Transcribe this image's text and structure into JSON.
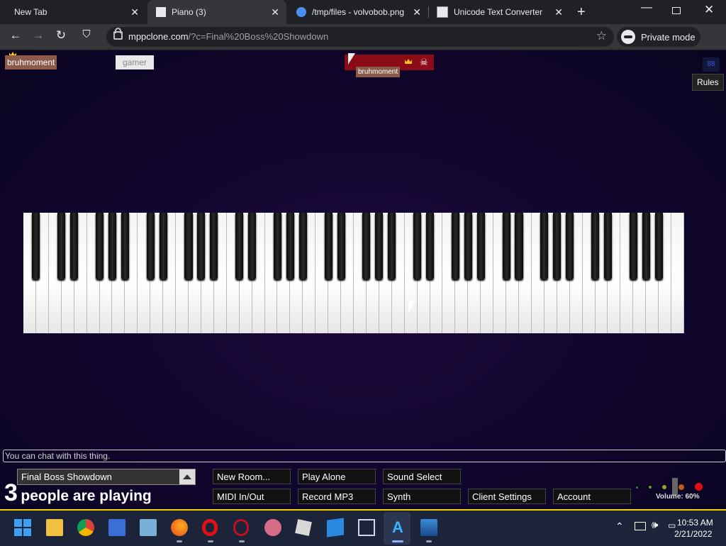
{
  "tabs": [
    {
      "title": "New Tab",
      "active": false
    },
    {
      "title": "Piano (3)",
      "active": true
    },
    {
      "title": "/tmp/files - volvobob.png",
      "active": false
    },
    {
      "title": "Unicode Text Converter",
      "active": false
    }
  ],
  "address": {
    "host": "mppclone.com",
    "path": "/?c=Final%20Boss%20Showdown",
    "private_label": "Private mode"
  },
  "players": {
    "tag1": "bruhmoment",
    "tag2": "gamer",
    "tag3": "bruhmoment"
  },
  "rules_label": "Rules",
  "chat_placeholder": "You can chat with this thing.",
  "room": {
    "name": "Final Boss Showdown"
  },
  "player_count": {
    "number": "3",
    "text": "people are playing"
  },
  "buttons": {
    "new_room": "New Room...",
    "play_alone": "Play Alone",
    "sound_select": "Sound Select",
    "midi": "MIDI In/Out",
    "record": "Record MP3",
    "synth": "Synth",
    "client_settings": "Client Settings",
    "account": "Account"
  },
  "volume": {
    "label": "Volume: 60%",
    "value": 0.6
  },
  "clock": {
    "time": "10:53 AM",
    "date": "2/21/2022"
  },
  "colors": {
    "accent_taskbar_border": "#f5d000",
    "tag_brown": "#8b5a4a",
    "owner_red": "#8b0c16"
  }
}
